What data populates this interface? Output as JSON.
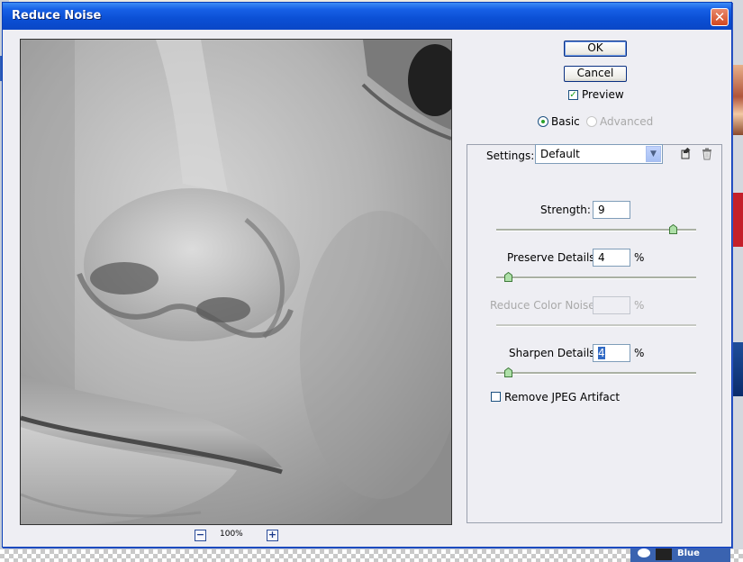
{
  "dialog": {
    "title": "Reduce Noise",
    "close_glyph": "✕"
  },
  "buttons": {
    "ok": "OK",
    "cancel": "Cancel"
  },
  "preview": {
    "checkbox_glyph": "✓",
    "label": "Preview",
    "checked": true
  },
  "mode": {
    "basic_label": "Basic",
    "advanced_label": "Advanced",
    "selected": "Basic"
  },
  "zoom": {
    "level": "100%",
    "minus": "−",
    "plus": "+"
  },
  "settings": {
    "label": "Settings:",
    "value": "Default",
    "arrow": "▼",
    "icons": [
      "save-preset-icon",
      "delete-preset-icon"
    ]
  },
  "params": {
    "strength": {
      "label": "Strength:",
      "value": "9",
      "unit": "",
      "slider_fraction": 0.9
    },
    "preserve": {
      "label": "Preserve Details:",
      "value": "4",
      "unit": "%",
      "slider_fraction": 0.04
    },
    "color_noise": {
      "label": "Reduce Color Noise:",
      "value": "",
      "unit": "%",
      "disabled": true
    },
    "sharpen": {
      "label": "Sharpen Details:",
      "value": "4",
      "unit": "%",
      "slider_fraction": 0.04
    }
  },
  "jpeg": {
    "label": "Remove JPEG Artifact",
    "checked": false
  },
  "background": {
    "layer_name": "Blue"
  }
}
